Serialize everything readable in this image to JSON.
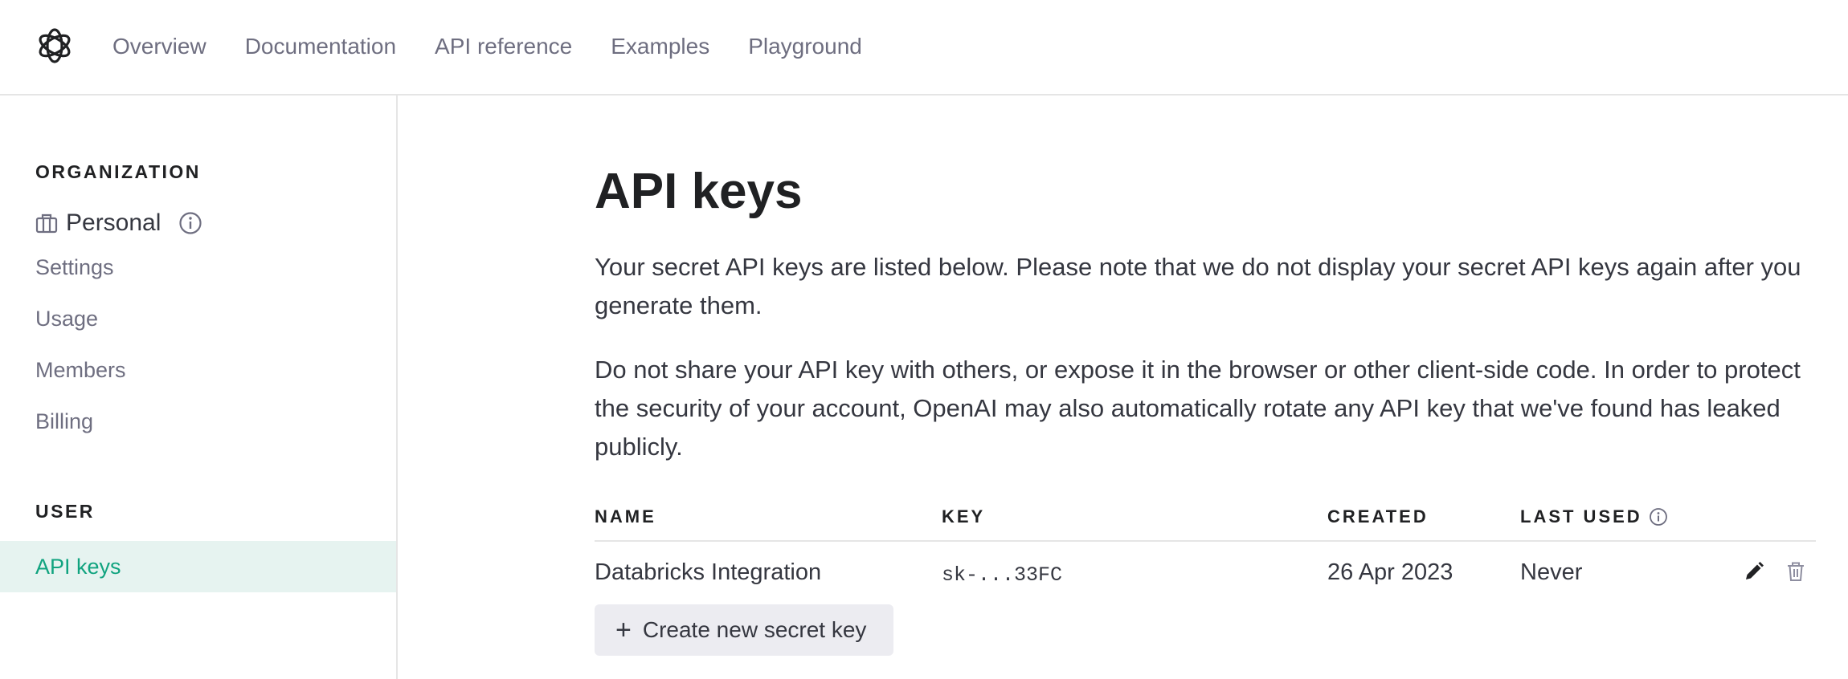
{
  "header": {
    "logo_icon": "openai-logo-icon",
    "nav": [
      {
        "label": "Overview"
      },
      {
        "label": "Documentation"
      },
      {
        "label": "API reference"
      },
      {
        "label": "Examples"
      },
      {
        "label": "Playground"
      }
    ]
  },
  "sidebar": {
    "org_heading": "ORGANIZATION",
    "org_name": "Personal",
    "org_icon": "briefcase-icon",
    "org_info_icon": "info-icon",
    "org_items": [
      {
        "label": "Settings"
      },
      {
        "label": "Usage"
      },
      {
        "label": "Members"
      },
      {
        "label": "Billing"
      }
    ],
    "user_heading": "USER",
    "user_items": [
      {
        "label": "API keys",
        "active": true
      }
    ],
    "active_color": "#10a37f",
    "active_bg": "#e6f3f0"
  },
  "main": {
    "title": "API keys",
    "para1": "Your secret API keys are listed below. Please note that we do not display your secret API keys again after you generate them.",
    "para2": "Do not share your API key with others, or expose it in the browser or other client-side code. In order to protect the security of your account, OpenAI may also automatically rotate any API key that we've found has leaked publicly.",
    "table": {
      "columns": [
        "NAME",
        "KEY",
        "CREATED",
        "LAST USED"
      ],
      "rows": [
        {
          "name": "Databricks Integration",
          "key": "sk-...33FC",
          "created": "26 Apr 2023",
          "last_used": "Never",
          "actions": [
            "pencil-icon",
            "trash-icon"
          ]
        }
      ]
    },
    "create_button": {
      "icon": "plus-icon",
      "plus_glyph": "+",
      "label": "Create new secret key"
    }
  }
}
